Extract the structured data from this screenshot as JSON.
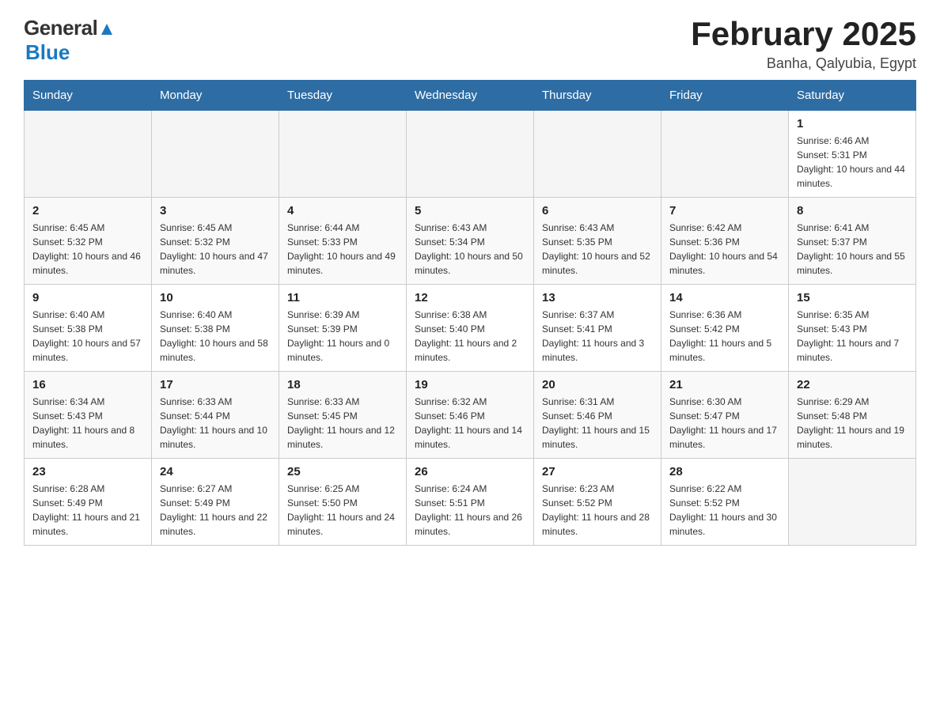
{
  "header": {
    "logo_general": "General",
    "logo_blue": "Blue",
    "title": "February 2025",
    "subtitle": "Banha, Qalyubia, Egypt"
  },
  "days_of_week": [
    "Sunday",
    "Monday",
    "Tuesday",
    "Wednesday",
    "Thursday",
    "Friday",
    "Saturday"
  ],
  "weeks": [
    [
      {
        "day": "",
        "sunrise": "",
        "sunset": "",
        "daylight": ""
      },
      {
        "day": "",
        "sunrise": "",
        "sunset": "",
        "daylight": ""
      },
      {
        "day": "",
        "sunrise": "",
        "sunset": "",
        "daylight": ""
      },
      {
        "day": "",
        "sunrise": "",
        "sunset": "",
        "daylight": ""
      },
      {
        "day": "",
        "sunrise": "",
        "sunset": "",
        "daylight": ""
      },
      {
        "day": "",
        "sunrise": "",
        "sunset": "",
        "daylight": ""
      },
      {
        "day": "1",
        "sunrise": "Sunrise: 6:46 AM",
        "sunset": "Sunset: 5:31 PM",
        "daylight": "Daylight: 10 hours and 44 minutes."
      }
    ],
    [
      {
        "day": "2",
        "sunrise": "Sunrise: 6:45 AM",
        "sunset": "Sunset: 5:32 PM",
        "daylight": "Daylight: 10 hours and 46 minutes."
      },
      {
        "day": "3",
        "sunrise": "Sunrise: 6:45 AM",
        "sunset": "Sunset: 5:32 PM",
        "daylight": "Daylight: 10 hours and 47 minutes."
      },
      {
        "day": "4",
        "sunrise": "Sunrise: 6:44 AM",
        "sunset": "Sunset: 5:33 PM",
        "daylight": "Daylight: 10 hours and 49 minutes."
      },
      {
        "day": "5",
        "sunrise": "Sunrise: 6:43 AM",
        "sunset": "Sunset: 5:34 PM",
        "daylight": "Daylight: 10 hours and 50 minutes."
      },
      {
        "day": "6",
        "sunrise": "Sunrise: 6:43 AM",
        "sunset": "Sunset: 5:35 PM",
        "daylight": "Daylight: 10 hours and 52 minutes."
      },
      {
        "day": "7",
        "sunrise": "Sunrise: 6:42 AM",
        "sunset": "Sunset: 5:36 PM",
        "daylight": "Daylight: 10 hours and 54 minutes."
      },
      {
        "day": "8",
        "sunrise": "Sunrise: 6:41 AM",
        "sunset": "Sunset: 5:37 PM",
        "daylight": "Daylight: 10 hours and 55 minutes."
      }
    ],
    [
      {
        "day": "9",
        "sunrise": "Sunrise: 6:40 AM",
        "sunset": "Sunset: 5:38 PM",
        "daylight": "Daylight: 10 hours and 57 minutes."
      },
      {
        "day": "10",
        "sunrise": "Sunrise: 6:40 AM",
        "sunset": "Sunset: 5:38 PM",
        "daylight": "Daylight: 10 hours and 58 minutes."
      },
      {
        "day": "11",
        "sunrise": "Sunrise: 6:39 AM",
        "sunset": "Sunset: 5:39 PM",
        "daylight": "Daylight: 11 hours and 0 minutes."
      },
      {
        "day": "12",
        "sunrise": "Sunrise: 6:38 AM",
        "sunset": "Sunset: 5:40 PM",
        "daylight": "Daylight: 11 hours and 2 minutes."
      },
      {
        "day": "13",
        "sunrise": "Sunrise: 6:37 AM",
        "sunset": "Sunset: 5:41 PM",
        "daylight": "Daylight: 11 hours and 3 minutes."
      },
      {
        "day": "14",
        "sunrise": "Sunrise: 6:36 AM",
        "sunset": "Sunset: 5:42 PM",
        "daylight": "Daylight: 11 hours and 5 minutes."
      },
      {
        "day": "15",
        "sunrise": "Sunrise: 6:35 AM",
        "sunset": "Sunset: 5:43 PM",
        "daylight": "Daylight: 11 hours and 7 minutes."
      }
    ],
    [
      {
        "day": "16",
        "sunrise": "Sunrise: 6:34 AM",
        "sunset": "Sunset: 5:43 PM",
        "daylight": "Daylight: 11 hours and 8 minutes."
      },
      {
        "day": "17",
        "sunrise": "Sunrise: 6:33 AM",
        "sunset": "Sunset: 5:44 PM",
        "daylight": "Daylight: 11 hours and 10 minutes."
      },
      {
        "day": "18",
        "sunrise": "Sunrise: 6:33 AM",
        "sunset": "Sunset: 5:45 PM",
        "daylight": "Daylight: 11 hours and 12 minutes."
      },
      {
        "day": "19",
        "sunrise": "Sunrise: 6:32 AM",
        "sunset": "Sunset: 5:46 PM",
        "daylight": "Daylight: 11 hours and 14 minutes."
      },
      {
        "day": "20",
        "sunrise": "Sunrise: 6:31 AM",
        "sunset": "Sunset: 5:46 PM",
        "daylight": "Daylight: 11 hours and 15 minutes."
      },
      {
        "day": "21",
        "sunrise": "Sunrise: 6:30 AM",
        "sunset": "Sunset: 5:47 PM",
        "daylight": "Daylight: 11 hours and 17 minutes."
      },
      {
        "day": "22",
        "sunrise": "Sunrise: 6:29 AM",
        "sunset": "Sunset: 5:48 PM",
        "daylight": "Daylight: 11 hours and 19 minutes."
      }
    ],
    [
      {
        "day": "23",
        "sunrise": "Sunrise: 6:28 AM",
        "sunset": "Sunset: 5:49 PM",
        "daylight": "Daylight: 11 hours and 21 minutes."
      },
      {
        "day": "24",
        "sunrise": "Sunrise: 6:27 AM",
        "sunset": "Sunset: 5:49 PM",
        "daylight": "Daylight: 11 hours and 22 minutes."
      },
      {
        "day": "25",
        "sunrise": "Sunrise: 6:25 AM",
        "sunset": "Sunset: 5:50 PM",
        "daylight": "Daylight: 11 hours and 24 minutes."
      },
      {
        "day": "26",
        "sunrise": "Sunrise: 6:24 AM",
        "sunset": "Sunset: 5:51 PM",
        "daylight": "Daylight: 11 hours and 26 minutes."
      },
      {
        "day": "27",
        "sunrise": "Sunrise: 6:23 AM",
        "sunset": "Sunset: 5:52 PM",
        "daylight": "Daylight: 11 hours and 28 minutes."
      },
      {
        "day": "28",
        "sunrise": "Sunrise: 6:22 AM",
        "sunset": "Sunset: 5:52 PM",
        "daylight": "Daylight: 11 hours and 30 minutes."
      },
      {
        "day": "",
        "sunrise": "",
        "sunset": "",
        "daylight": ""
      }
    ]
  ]
}
